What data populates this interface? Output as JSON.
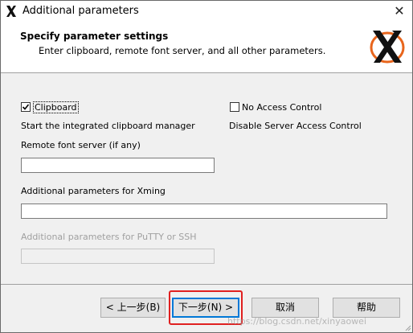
{
  "window": {
    "title": "Additional parameters",
    "close_symbol": "✕"
  },
  "header": {
    "title": "Specify parameter settings",
    "subtitle": "Enter clipboard, remote font server, and all other parameters.",
    "logo_icon": "xming-x-logo"
  },
  "options": {
    "clipboard": {
      "label": "Clipboard",
      "checked": true,
      "description": "Start the integrated clipboard manager"
    },
    "no_access_control": {
      "label": "No Access Control",
      "checked": false,
      "description": "Disable Server Access Control"
    }
  },
  "fields": {
    "remote_font": {
      "label": "Remote font server (if any)",
      "value": ""
    },
    "xming_params": {
      "label": "Additional parameters for Xming",
      "value": ""
    },
    "putty_params": {
      "label": "Additional parameters for PuTTY or SSH",
      "value": "",
      "disabled": true
    }
  },
  "buttons": {
    "back": "< 上一步(B)",
    "next": "下一步(N) >",
    "cancel": "取消",
    "help": "帮助"
  },
  "watermark": "https://blog.csdn.net/xinyaowei",
  "colors": {
    "highlight_box": "#e02020",
    "logo_orange": "#e8651c",
    "default_button_border": "#0078d7"
  }
}
